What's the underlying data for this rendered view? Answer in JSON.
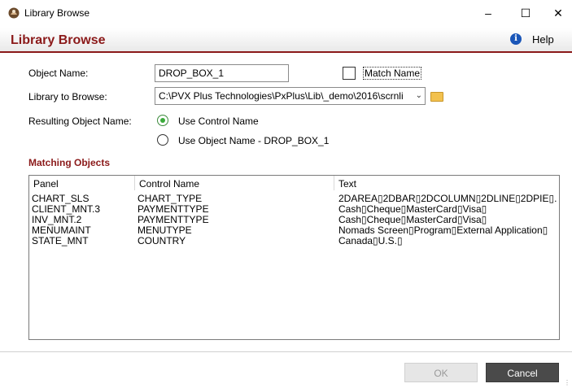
{
  "window": {
    "title": "Library Browse",
    "minimize": "–",
    "maximize": "☐",
    "close": "✕"
  },
  "header": {
    "title": "Library Browse",
    "help_label": "Help",
    "help_icon": "info-icon"
  },
  "form": {
    "object_name_label": "Object Name:",
    "object_name_value": "DROP_BOX_1",
    "match_name_label": "Match Name",
    "match_name_checked": false,
    "library_label": "Library to Browse:",
    "library_value": "C:\\PVX Plus Technologies\\PxPlus\\Lib\\_demo\\2016\\scrnli",
    "resulting_label": "Resulting Object Name:",
    "option_control": "Use Control Name",
    "option_object": "Use Object Name - DROP_BOX_1",
    "selected_option": "Use Control Name"
  },
  "matching": {
    "title": "Matching Objects",
    "columns": [
      "Panel",
      "Control Name",
      "Text"
    ],
    "rows": [
      {
        "panel": "CHART_SLS",
        "control": "CHART_TYPE",
        "text": "2DAREA▯2DBAR▯2DCOLUMN▯2DLINE▯2DPIE▯..."
      },
      {
        "panel": "CLIENT_MNT.3",
        "control": "PAYMENTTYPE",
        "text": "Cash▯Cheque▯MasterCard▯Visa▯"
      },
      {
        "panel": "INV_MNT.2",
        "control": "PAYMENTTYPE",
        "text": "Cash▯Cheque▯MasterCard▯Visa▯"
      },
      {
        "panel": "MENUMAINT",
        "control": "MENUTYPE",
        "text": "Nomads Screen▯Program▯External Application▯"
      },
      {
        "panel": "STATE_MNT",
        "control": "COUNTRY",
        "text": "Canada▯U.S.▯"
      }
    ]
  },
  "buttons": {
    "ok": "OK",
    "cancel": "Cancel"
  },
  "colors": {
    "accent": "#8b1a1a",
    "radio_selected": "#3aaa3a",
    "cancel_bg": "#4a4a4a"
  }
}
